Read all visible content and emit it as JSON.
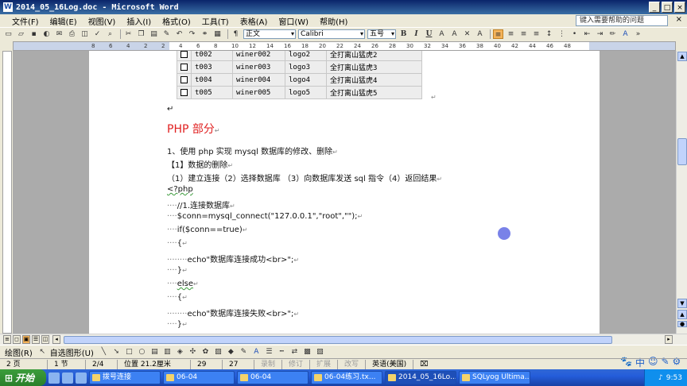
{
  "window": {
    "title": "2014_05_16Log.doc - Microsoft Word",
    "icon_letter": "W"
  },
  "menu": {
    "items": [
      "文件(F)",
      "编辑(E)",
      "视图(V)",
      "插入(I)",
      "格式(O)",
      "工具(T)",
      "表格(A)",
      "窗口(W)",
      "帮助(H)"
    ],
    "help_placeholder": "键入需要帮助的问题",
    "close": "×"
  },
  "toolbar": {
    "style": "正文",
    "font": "Calibri",
    "size": "五号",
    "bold": "B",
    "italic": "I",
    "underline": "U"
  },
  "ruler": {
    "labels": [
      "8",
      "6",
      "4",
      "2",
      "2",
      "4",
      "6",
      "8",
      "10",
      "12",
      "14",
      "16",
      "18",
      "20",
      "22",
      "24",
      "26",
      "28",
      "30",
      "32",
      "34",
      "36",
      "38",
      "40",
      "42",
      "44",
      "46",
      "48"
    ]
  },
  "table": {
    "rows": [
      [
        "t002",
        "winer002",
        "logo2",
        "全打离山猛虎2"
      ],
      [
        "t003",
        "winer003",
        "logo3",
        "全打离山猛虎3"
      ],
      [
        "t004",
        "winer004",
        "logo4",
        "全打离山猛虎4"
      ],
      [
        "t005",
        "winer005",
        "logo5",
        "全打离山猛虎5"
      ]
    ]
  },
  "doc": {
    "heading": "PHP 部分",
    "line1": "1、使用 php 实现 mysql 数据库的修改、删除",
    "line2": "【1】数据的删除",
    "line3": "（1）建立连接（2）选择数据库 （3）向数据库发送 sql 指令（4）返回结果",
    "line4": "<?php",
    "line5": "//1.连接数据库",
    "line6": "$conn=mysql_connect(\"127.0.0.1\",\"root\",\"\");",
    "line7": "if($conn==true)",
    "line8": "{",
    "line9": "echo\"数据库连接成功<br>\";",
    "line10": "}",
    "line11": "else",
    "line12": "{",
    "line13": "echo\"数据库连接失败<br>\";",
    "line14": "}",
    "para_mark": "↵",
    "indent_dots4": "····",
    "indent_dots8": "········"
  },
  "drawbar": {
    "draw": "绘图(R)",
    "autoshapes": "自选图形(U)"
  },
  "status": {
    "page": "2 页",
    "section": "1 节",
    "pages": "2/4",
    "position": "位置 21.2厘米",
    "line": "29 行",
    "column": "27 列",
    "rec": "录制",
    "trk": "修订",
    "ext": "扩展",
    "ovr": "改写",
    "language": "英语(美国)"
  },
  "taskbar": {
    "start": "开始",
    "tasks": [
      "拨号连接",
      "06-04",
      "06-04",
      "06-04练习.tx...",
      "2014_05_16Lo...",
      "SQLyog Ultima..."
    ],
    "clock": "9:53"
  },
  "ime": {
    "chars": [
      "中",
      "☺",
      "✎",
      "⚙"
    ]
  },
  "colors": {
    "heading": "#E02020",
    "titlebar": "#0A246A",
    "taskbar": "#245DDA"
  }
}
